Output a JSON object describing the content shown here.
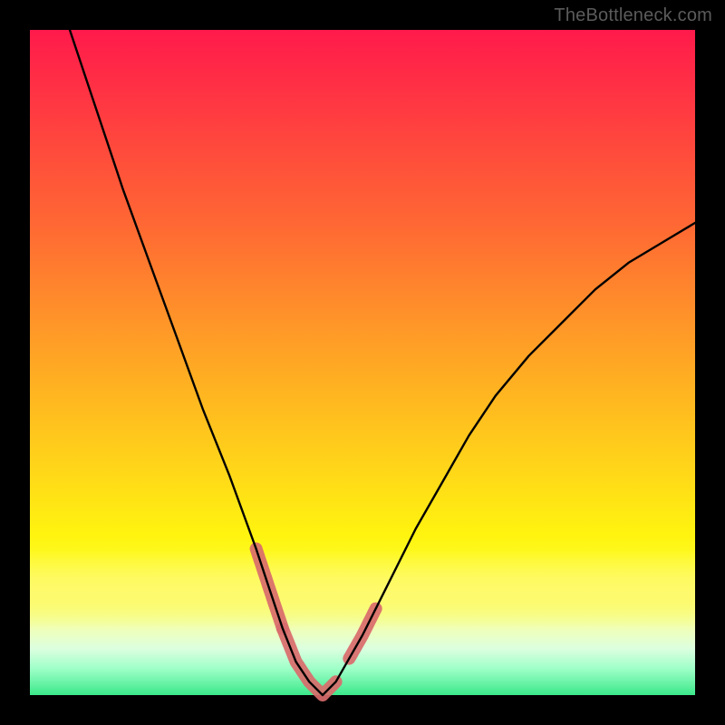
{
  "watermark": "TheBottleneck.com",
  "chart_data": {
    "type": "line",
    "title": "",
    "xlabel": "",
    "ylabel": "",
    "xlim": [
      0,
      100
    ],
    "ylim": [
      0,
      100
    ],
    "grid": false,
    "x": [
      6,
      10,
      14,
      18,
      22,
      26,
      30,
      34,
      36,
      38,
      40,
      42,
      44,
      46,
      50,
      54,
      58,
      62,
      66,
      70,
      75,
      80,
      85,
      90,
      95,
      100
    ],
    "values": [
      100,
      88,
      76,
      65,
      54,
      43,
      33,
      22,
      16,
      10,
      5,
      2,
      0,
      2,
      9,
      17,
      25,
      32,
      39,
      45,
      51,
      56,
      61,
      65,
      68,
      71
    ],
    "highlight_segments": [
      {
        "from_x": 34,
        "to_x": 38,
        "color": "#d96b6b",
        "width": 14
      },
      {
        "from_x": 38,
        "to_x": 46,
        "color": "#d96b6b",
        "width": 14
      },
      {
        "from_x": 48,
        "to_x": 52,
        "color": "#d96b6b",
        "width": 14
      }
    ],
    "colors": {
      "curve": "#000000",
      "highlight": "#d96b6b"
    }
  }
}
